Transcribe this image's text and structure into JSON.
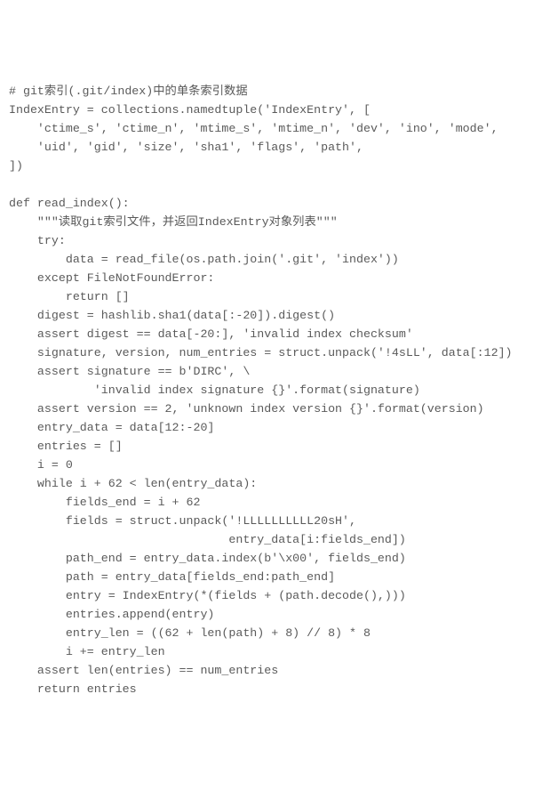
{
  "code": {
    "lines": [
      "# git索引(.git/index)中的单条索引数据",
      "IndexEntry = collections.namedtuple('IndexEntry', [",
      "    'ctime_s', 'ctime_n', 'mtime_s', 'mtime_n', 'dev', 'ino', 'mode',",
      "    'uid', 'gid', 'size', 'sha1', 'flags', 'path',",
      "])",
      "",
      "def read_index():",
      "    \"\"\"读取git索引文件，并返回IndexEntry对象列表\"\"\"",
      "    try:",
      "        data = read_file(os.path.join('.git', 'index'))",
      "    except FileNotFoundError:",
      "        return []",
      "    digest = hashlib.sha1(data[:-20]).digest()",
      "    assert digest == data[-20:], 'invalid index checksum'",
      "    signature, version, num_entries = struct.unpack('!4sLL', data[:12])",
      "    assert signature == b'DIRC', \\",
      "            'invalid index signature {}'.format(signature)",
      "    assert version == 2, 'unknown index version {}'.format(version)",
      "    entry_data = data[12:-20]",
      "    entries = []",
      "    i = 0",
      "    while i + 62 < len(entry_data):",
      "        fields_end = i + 62",
      "        fields = struct.unpack('!LLLLLLLLLL20sH',",
      "                               entry_data[i:fields_end])",
      "        path_end = entry_data.index(b'\\x00', fields_end)",
      "        path = entry_data[fields_end:path_end]",
      "        entry = IndexEntry(*(fields + (path.decode(),)))",
      "        entries.append(entry)",
      "        entry_len = ((62 + len(path) + 8) // 8) * 8",
      "        i += entry_len",
      "    assert len(entries) == num_entries",
      "    return entries"
    ]
  }
}
